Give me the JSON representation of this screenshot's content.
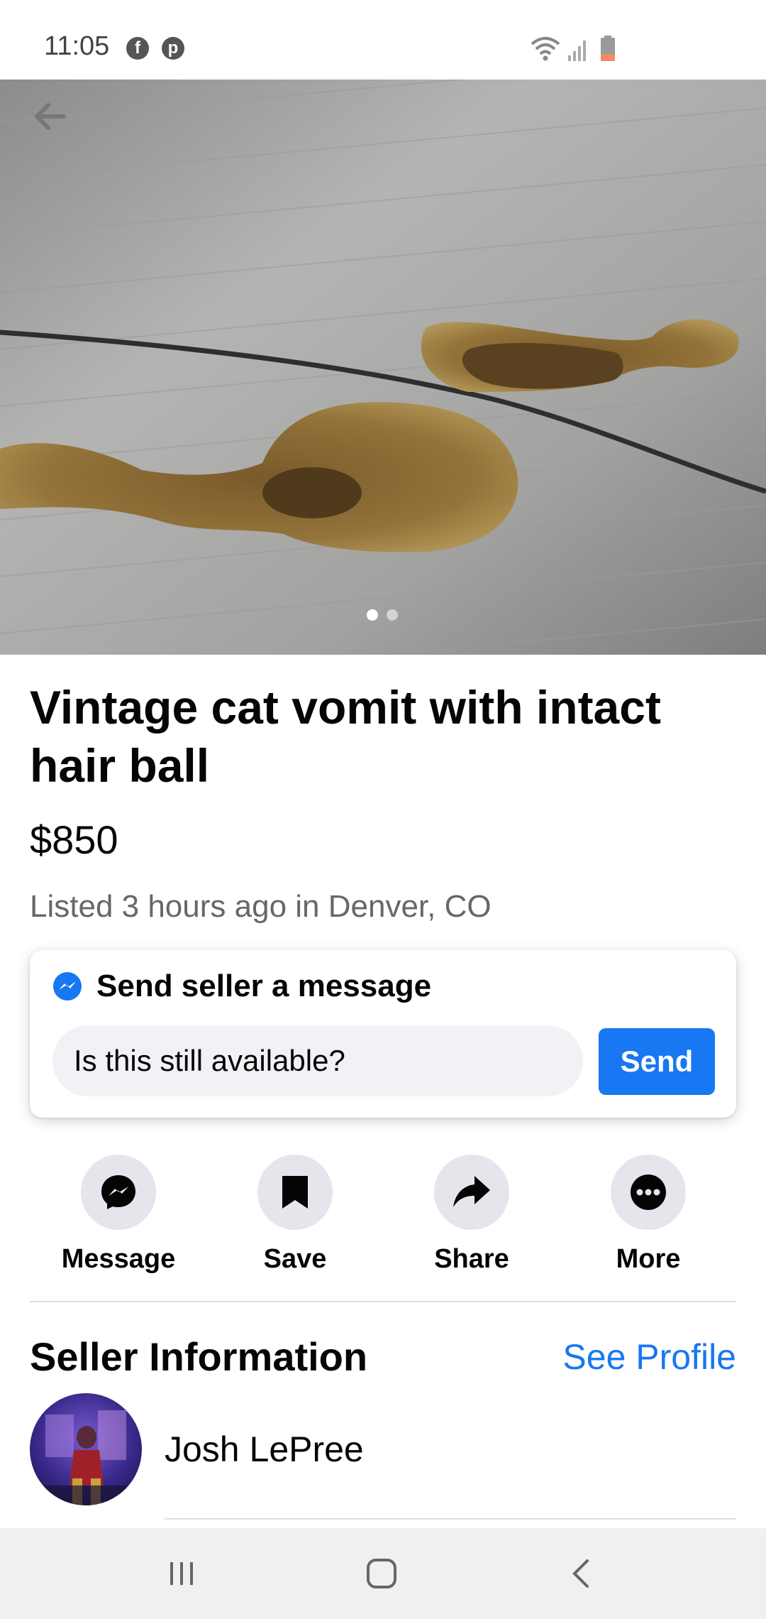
{
  "status_bar": {
    "time": "11:05",
    "app_icons": [
      "facebook-icon",
      "pinterest-icon"
    ],
    "right_icons": [
      "wifi-icon",
      "signal-icon",
      "battery-icon"
    ]
  },
  "hero": {
    "back_icon": "arrow-left-icon",
    "image_count": 2,
    "active_image": 1
  },
  "listing": {
    "title": "Vintage cat vomit with intact hair ball",
    "price": "$850",
    "listed": "Listed 3 hours ago in Denver, CO"
  },
  "message_card": {
    "header": "Send seller a message",
    "input_value": "Is this still available?",
    "send_label": "Send"
  },
  "actions": [
    {
      "label": "Message",
      "icon": "messenger-icon"
    },
    {
      "label": "Save",
      "icon": "bookmark-icon"
    },
    {
      "label": "Share",
      "icon": "share-icon"
    },
    {
      "label": "More",
      "icon": "more-icon"
    }
  ],
  "seller": {
    "heading": "Seller Information",
    "see_profile": "See Profile",
    "name": "Josh LePree"
  },
  "colors": {
    "accent": "#1877f2",
    "secondary_text": "#65676b",
    "action_bg": "#e4e6eb"
  }
}
